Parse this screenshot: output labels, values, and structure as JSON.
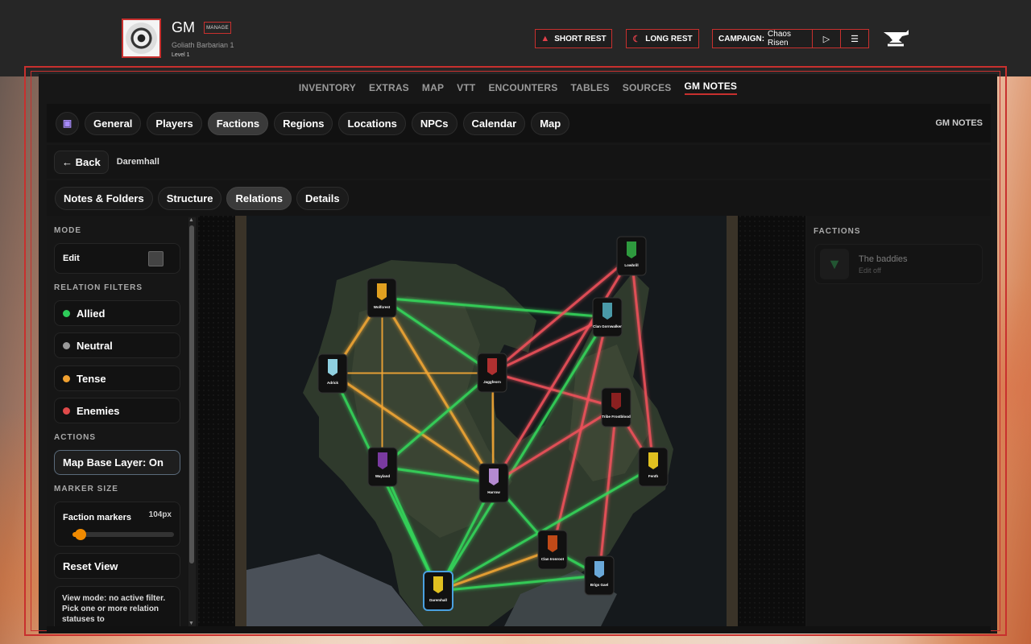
{
  "header": {
    "name": "GM",
    "manage_label": "MANAGE",
    "subtitle": "Goliath  Barbarian 1",
    "level": "Level 1",
    "short_rest": "SHORT REST",
    "long_rest": "LONG REST",
    "campaign_prefix": "CAMPAIGN:",
    "campaign_name": "Chaos Risen",
    "accent_color": "#c8302e"
  },
  "nav": {
    "tabs": [
      "INVENTORY",
      "EXTRAS",
      "MAP",
      "VTT",
      "ENCOUNTERS",
      "TABLES",
      "SOURCES",
      "GM NOTES"
    ],
    "active": "GM NOTES"
  },
  "gm_tabs": {
    "items": [
      "General",
      "Players",
      "Factions",
      "Regions",
      "Locations",
      "NPCs",
      "Calendar",
      "Map"
    ],
    "active": "Factions",
    "right_label": "GM NOTES"
  },
  "breadcrumb": {
    "back": "← Back",
    "current": "Daremhall"
  },
  "sub_tabs": {
    "items": [
      "Notes & Folders",
      "Structure",
      "Relations",
      "Details"
    ],
    "active": "Relations"
  },
  "sidebar": {
    "mode_heading": "MODE",
    "edit_label": "Edit",
    "edit_checked": false,
    "filters_heading": "RELATION FILTERS",
    "filters": [
      {
        "label": "Allied",
        "color": "#2ecc5a"
      },
      {
        "label": "Neutral",
        "color": "#9a9a9a"
      },
      {
        "label": "Tense",
        "color": "#f0a030"
      },
      {
        "label": "Enemies",
        "color": "#e04a4a"
      }
    ],
    "actions_heading": "ACTIONS",
    "map_base_layer": "Map Base Layer: On",
    "marker_heading": "MARKER SIZE",
    "faction_markers_label": "Faction markers",
    "faction_markers_value": "104px",
    "faction_markers_level": 0.08,
    "reset_view": "Reset View",
    "view_note": "View mode: no active filter. Pick one or more relation statuses to"
  },
  "map": {
    "nodes": [
      {
        "id": "lowbrill",
        "label": "Lowbrill",
        "color": "#2e9a3e"
      },
      {
        "id": "wolfcrest",
        "label": "Wolfcrest",
        "color": "#e0a020"
      },
      {
        "id": "clan",
        "label": "Clan Gornwalker",
        "color": "#4a9aa8"
      },
      {
        "id": "adrick",
        "label": "Adrick",
        "color": "#8fd0e0"
      },
      {
        "id": "jagg",
        "label": "Jaggfeorn",
        "color": "#b03030"
      },
      {
        "id": "tribe",
        "label": "Tribe Frostblood",
        "color": "#8a2020"
      },
      {
        "id": "wayland",
        "label": "Wayland",
        "color": "#7a3aa0"
      },
      {
        "id": "harrow",
        "label": "Harrow",
        "color": "#b48ad0"
      },
      {
        "id": "fenth",
        "label": "Fenth",
        "color": "#e0c020"
      },
      {
        "id": "ironroot",
        "label": "Clan Ironroot",
        "color": "#c04a18"
      },
      {
        "id": "brigs",
        "label": "Brigs Gael",
        "color": "#6aa8d8"
      },
      {
        "id": "daremhall",
        "label": "Daremhall",
        "color": "#e0c020"
      }
    ],
    "relations": [
      {
        "a": "wolfcrest",
        "b": "clan",
        "status": "allied"
      },
      {
        "a": "wolfcrest",
        "b": "jagg",
        "status": "allied"
      },
      {
        "a": "wolfcrest",
        "b": "adrick",
        "status": "tense"
      },
      {
        "a": "wolfcrest",
        "b": "wayland",
        "status": "tense"
      },
      {
        "a": "wolfcrest",
        "b": "harrow",
        "status": "tense"
      },
      {
        "a": "adrick",
        "b": "jagg",
        "status": "tense"
      },
      {
        "a": "adrick",
        "b": "harrow",
        "status": "tense"
      },
      {
        "a": "adrick",
        "b": "daremhall",
        "status": "allied"
      },
      {
        "a": "jagg",
        "b": "lowbrill",
        "status": "enemies"
      },
      {
        "a": "jagg",
        "b": "clan",
        "status": "enemies"
      },
      {
        "a": "jagg",
        "b": "tribe",
        "status": "enemies"
      },
      {
        "a": "jagg",
        "b": "harrow",
        "status": "tense"
      },
      {
        "a": "jagg",
        "b": "wayland",
        "status": "allied"
      },
      {
        "a": "lowbrill",
        "b": "fenth",
        "status": "enemies"
      },
      {
        "a": "lowbrill",
        "b": "harrow",
        "status": "enemies"
      },
      {
        "a": "clan",
        "b": "ironroot",
        "status": "enemies"
      },
      {
        "a": "clan",
        "b": "daremhall",
        "status": "allied"
      },
      {
        "a": "tribe",
        "b": "harrow",
        "status": "enemies"
      },
      {
        "a": "tribe",
        "b": "brigs",
        "status": "enemies"
      },
      {
        "a": "tribe",
        "b": "fenth",
        "status": "enemies"
      },
      {
        "a": "wayland",
        "b": "harrow",
        "status": "allied"
      },
      {
        "a": "wayland",
        "b": "daremhall",
        "status": "allied"
      },
      {
        "a": "harrow",
        "b": "daremhall",
        "status": "allied"
      },
      {
        "a": "harrow",
        "b": "ironroot",
        "status": "allied"
      },
      {
        "a": "fenth",
        "b": "daremhall",
        "status": "allied"
      },
      {
        "a": "ironroot",
        "b": "daremhall",
        "status": "tense"
      },
      {
        "a": "brigs",
        "b": "daremhall",
        "status": "allied"
      },
      {
        "a": "ironroot",
        "b": "brigs",
        "status": "allied"
      }
    ]
  },
  "right_panel": {
    "heading": "FACTIONS",
    "faction_name": "The baddies",
    "faction_status": "Edit off"
  }
}
